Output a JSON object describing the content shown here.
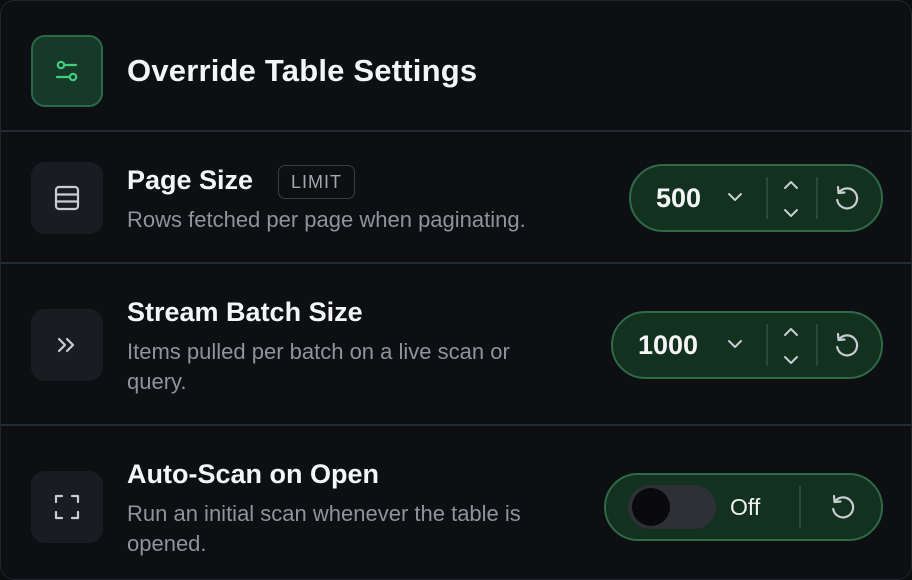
{
  "header": {
    "title": "Override Table Settings",
    "icon": "sliders-icon"
  },
  "settings": [
    {
      "label": "Page Size",
      "badge": "LIMIT",
      "description": "Rows fetched per page when paginating.",
      "value": "500",
      "icon": "table-rows-icon"
    },
    {
      "label": "Stream Batch Size",
      "description": "Items pulled per batch on a live scan or query.",
      "value": "1000",
      "icon": "double-chevron-right-icon"
    },
    {
      "label": "Auto-Scan on Open",
      "description": "Run an initial scan whenever the table is opened.",
      "toggle_state": "Off",
      "toggle_on": false,
      "icon": "scan-frame-icon"
    }
  ],
  "colors": {
    "accent": "#2f6a47",
    "accent_fill": "#13311f",
    "accent_icon": "#3ecf7a",
    "background": "#0e0f13"
  }
}
